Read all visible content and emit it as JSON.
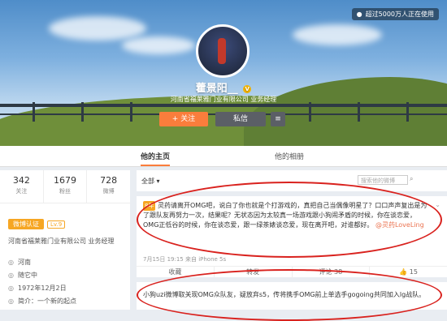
{
  "badge": {
    "text": "超过5000万人正在使用"
  },
  "profile": {
    "name": "藿景阳__",
    "company": "河南省福莱雅门业有限公司",
    "company_suffix": "业务经理",
    "follow_label": "+ 关注",
    "message_label": "私信",
    "more_icon": "menu-icon"
  },
  "tabs": {
    "home": "他的主页",
    "album": "他的相册"
  },
  "stats": [
    {
      "num": "342",
      "label": "关注"
    },
    {
      "num": "1679",
      "label": "粉丝"
    },
    {
      "num": "728",
      "label": "微博"
    }
  ],
  "verification": {
    "label": "微博认证",
    "level": "Lv.9"
  },
  "info": {
    "job": "河南省福莱雅门业有限公司 业务经理",
    "location": "河南",
    "sign": "随它中",
    "birthday": "1972年12月2日",
    "intro": "简介：一个新的起点"
  },
  "filter": {
    "all": "全部",
    "search_placeholder": "搜索他的微博"
  },
  "post1": {
    "badge": "8年",
    "text": "灵药请离开OMG吧，说白了你也就是个打游戏的，真把自己当偶像明星了？口口声声复出是为了跟队友再努力一次，结果呢？无状态因为太较真一场游戏跟小狗闹矛盾的时候，你在谈恋爱，OMG正低谷的时候，你在谈恋爱，跟一绿茶婊谈恋爱，现在离开吧，对谁都好。",
    "mention": "@灵药LoveLing",
    "meta": "7月15日 19:15 来自 iPhone 5s",
    "actions": [
      "收藏",
      "转发",
      "评论 38",
      "15"
    ],
    "chevron": "chevron-down-icon"
  },
  "post2": {
    "text": "小狗uzi微博取关现OMG众队友，疑放弃s5，传将携手OMG前上单选手gogoing共同加入lg战队。"
  }
}
